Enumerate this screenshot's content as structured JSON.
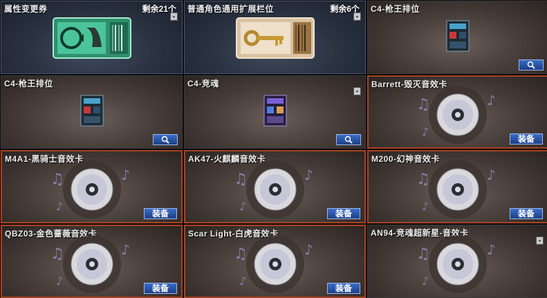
{
  "items": [
    {
      "title": "属性变更券",
      "count": "剩余21个",
      "art": "green-ticket",
      "button": "",
      "trash": true
    },
    {
      "title": "普通角色通用扩展栏位",
      "count": "剩余6个",
      "art": "key-ticket",
      "button": "",
      "trash": true
    },
    {
      "title": "C4-枪王排位",
      "count": "",
      "art": "c4-device",
      "button": "search",
      "trash": false
    },
    {
      "title": "C4-枪王排位",
      "count": "",
      "art": "c4-device",
      "button": "search",
      "trash": false
    },
    {
      "title": "C4-竞魂",
      "count": "",
      "art": "c4-device-purple",
      "button": "search",
      "trash": true
    },
    {
      "title": "Barrett-毁灭音效卡",
      "count": "",
      "art": "sound-disc",
      "button": "装备",
      "trash": false
    },
    {
      "title": "M4A1-黑骑士音效卡",
      "count": "",
      "art": "sound-disc",
      "button": "装备",
      "trash": false
    },
    {
      "title": "AK47-火麒麟音效卡",
      "count": "",
      "art": "sound-disc",
      "button": "装备",
      "trash": false
    },
    {
      "title": "M200-幻神音效卡",
      "count": "",
      "art": "sound-disc",
      "button": "装备",
      "trash": false
    },
    {
      "title": "QBZ03-金色蔷薇音效卡",
      "count": "",
      "art": "sound-disc",
      "button": "装备",
      "trash": false
    },
    {
      "title": "Scar Light-白虎音效卡",
      "count": "",
      "art": "sound-disc",
      "button": "装备",
      "trash": false
    },
    {
      "title": "AN94-竞魂超新星-音效卡",
      "count": "",
      "art": "sound-disc",
      "button": "装备",
      "trash": true
    }
  ],
  "colors": {
    "disc_border": "#a8431f",
    "button_blue": "#2a55a8",
    "ticket_green": "#3fae8a"
  }
}
